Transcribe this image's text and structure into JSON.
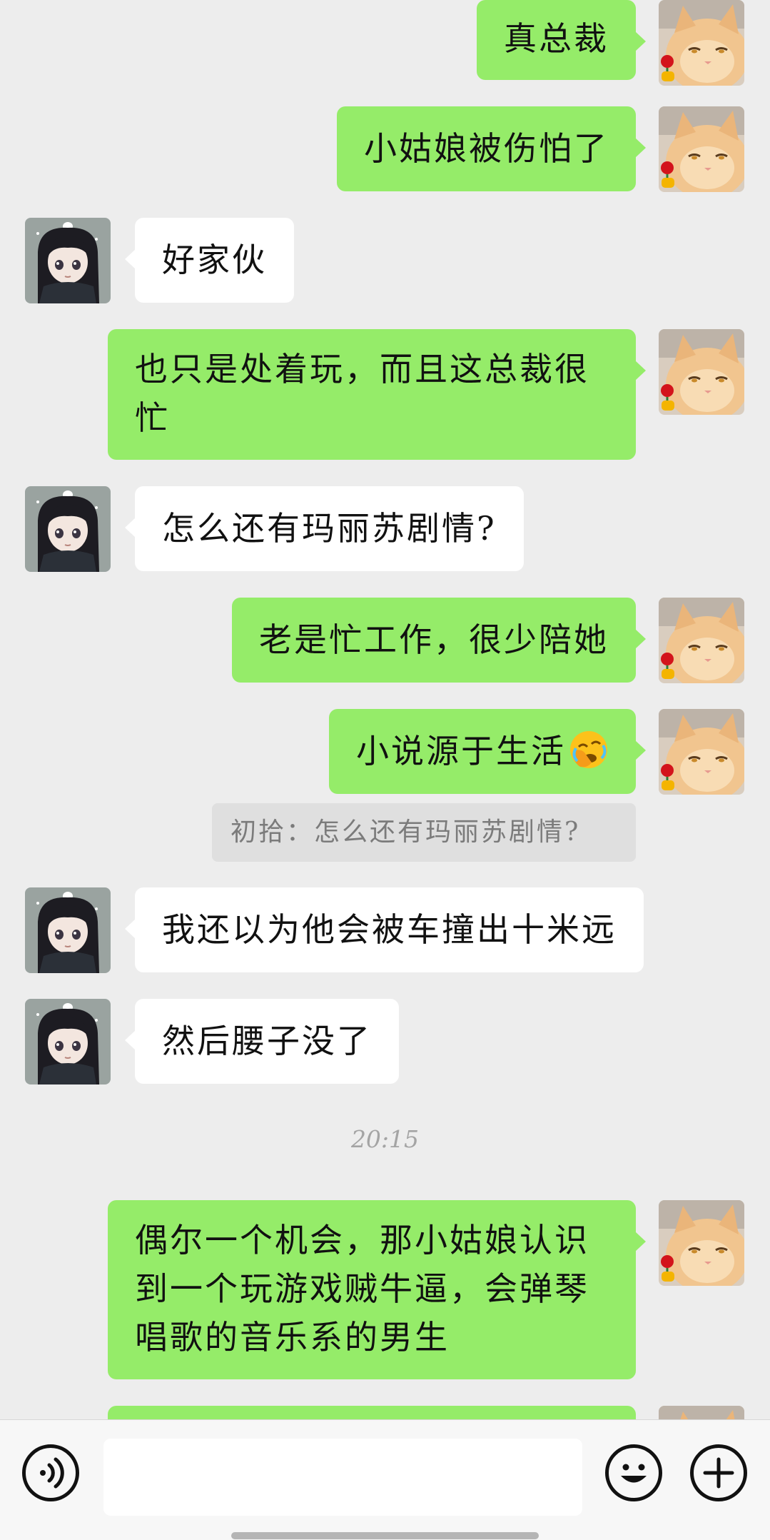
{
  "messages": [
    {
      "from": "me",
      "text": "真总裁"
    },
    {
      "from": "me",
      "text": "小姑娘被伤怕了"
    },
    {
      "from": "other",
      "text": "好家伙"
    },
    {
      "from": "me",
      "lines": [
        "也只是处着玩，而且这总裁很",
        "忙"
      ]
    },
    {
      "from": "other",
      "text": "怎么还有玛丽苏剧情?"
    },
    {
      "from": "me",
      "text": "老是忙工作，很少陪她"
    },
    {
      "from": "me",
      "text": "小说源于生活",
      "emoji": "facepalm-emoji"
    },
    {
      "from": "me",
      "quote": "初拾：怎么还有玛丽苏剧情?"
    },
    {
      "from": "other",
      "text": "我还以为他会被车撞出十米远"
    },
    {
      "from": "other",
      "text": "然后腰子没了"
    },
    {
      "from": "me",
      "lines": [
        "偶尔一个机会，那小姑娘认识",
        "到一个玩游戏贼牛逼，会弹琴",
        "唱歌的音乐系的男生"
      ]
    }
  ],
  "timestamp": "20:15",
  "input": {
    "value": "",
    "placeholder": ""
  },
  "icons": {
    "voice": "voice-icon",
    "emoji": "emoji-icon",
    "plus": "plus-icon"
  },
  "colors": {
    "my_bubble": "#95ec69",
    "other_bubble": "#ffffff",
    "background": "#ededed"
  }
}
